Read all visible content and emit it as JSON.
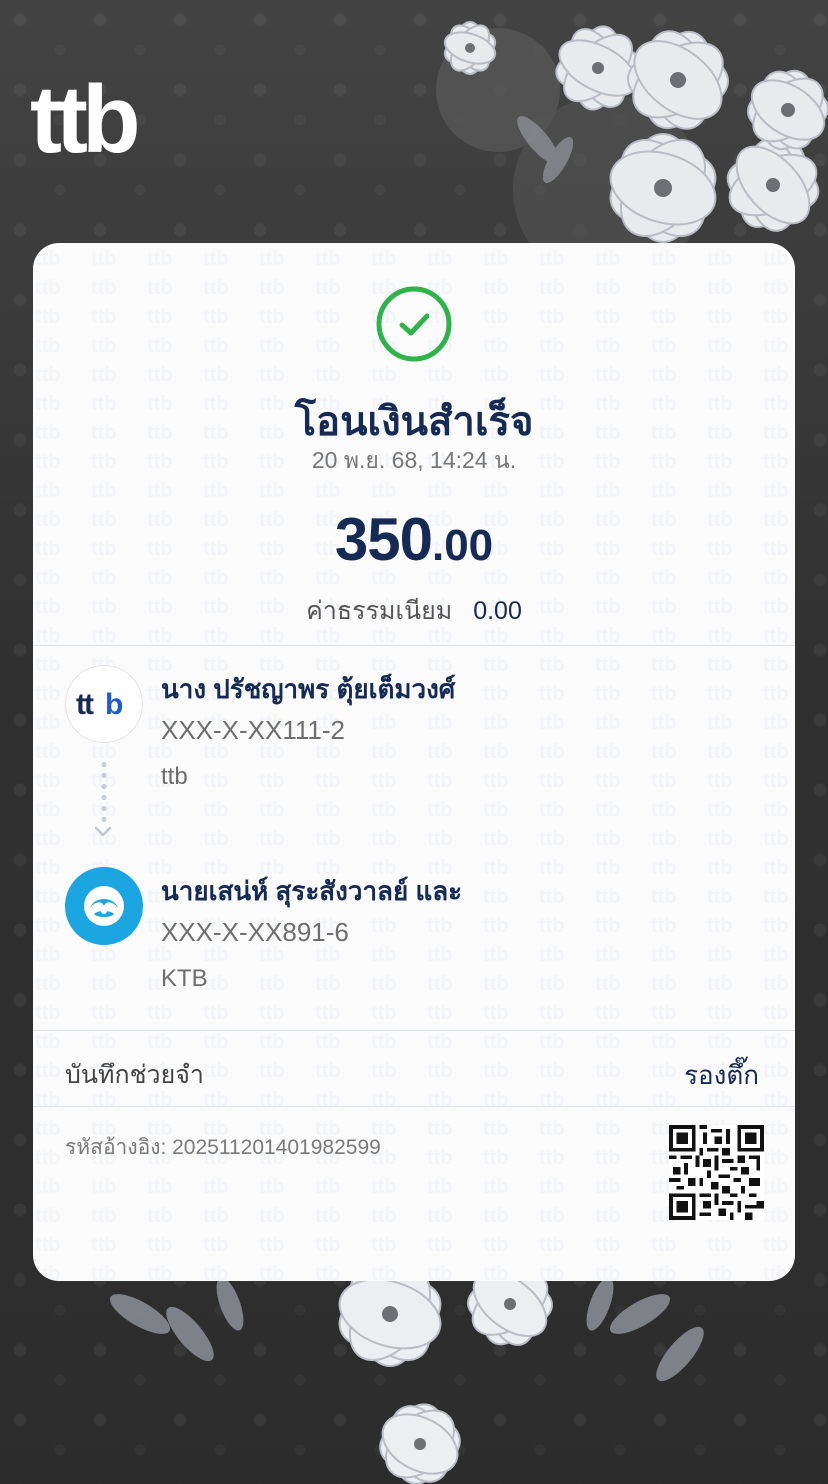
{
  "brand": {
    "logo_text": "ttb",
    "colors": {
      "navy": "#152a54",
      "success_green": "#2eb34a",
      "ktb_blue": "#1ba5e1",
      "background": "#3a3a3a"
    }
  },
  "receipt": {
    "status_icon": "check-circle-icon",
    "title": "โอนเงินสำเร็จ",
    "datetime": "20 พ.ย. 68, 14:24 น.",
    "amount_int": "350",
    "amount_dec": ".00",
    "fee_label": "ค่าธรรมเนียม",
    "fee_value": "0.00"
  },
  "sender": {
    "name": "นาง ปรัชญาพร ตุ้ยเต็มวงศ์",
    "account": "XXX-X-XX111-2",
    "bank": "ttb",
    "bank_logo": "ttb-logo-icon"
  },
  "receiver": {
    "name": "นายเสน่ห์ สุระสังวาลย์ และ",
    "account": "XXX-X-XX891-6",
    "bank": "KTB",
    "bank_logo": "ktb-logo-icon"
  },
  "memo": {
    "label": "บันทึกช่วยจำ",
    "value": "รองตึ๊ก"
  },
  "reference": {
    "text": "รหัสอ้างอิง: 2025112014019825​99"
  }
}
